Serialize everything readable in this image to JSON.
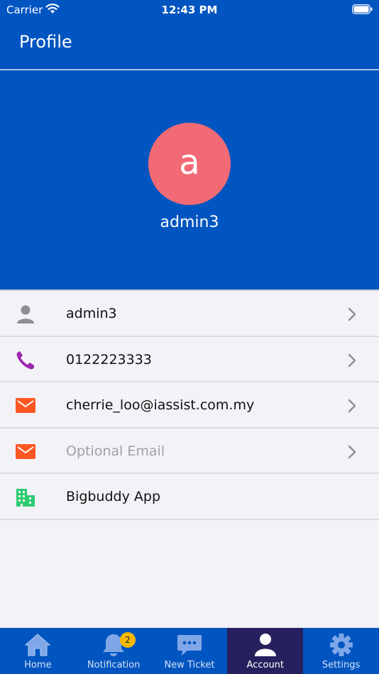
{
  "status_bar": {
    "carrier": "Carrier",
    "time": "12:43 PM",
    "icons": [
      "wifi-icon",
      "battery-icon"
    ]
  },
  "nav": {
    "title": "Profile"
  },
  "profile": {
    "avatar_letter": "a",
    "avatar_color": "#f16a75",
    "name": "admin3"
  },
  "info_rows": [
    {
      "label": "admin3",
      "icon": "user-icon",
      "icon_color": "#8e8e93",
      "chevron": true,
      "placeholder": false
    },
    {
      "label": "0122223333",
      "icon": "phone-icon",
      "icon_color": "#9c27b0",
      "chevron": true,
      "placeholder": false
    },
    {
      "label": "cherrie_loo@iassist.com.my",
      "icon": "mail-icon",
      "icon_color": "#ff5722",
      "chevron": true,
      "placeholder": false
    },
    {
      "label": "Optional Email",
      "icon": "mail-icon",
      "icon_color": "#ff5722",
      "chevron": true,
      "placeholder": true
    },
    {
      "label": "Bigbuddy App",
      "icon": "building-icon",
      "icon_color": "#2ecc71",
      "chevron": false,
      "placeholder": false
    }
  ],
  "tabs": [
    {
      "label": "Home",
      "icon": "home-icon",
      "active": false
    },
    {
      "label": "Notification",
      "icon": "bell-icon",
      "active": false,
      "badge": "2"
    },
    {
      "label": "New Ticket",
      "icon": "chat-icon",
      "active": false
    },
    {
      "label": "Account",
      "icon": "person-icon",
      "active": true
    },
    {
      "label": "Settings",
      "icon": "gear-icon",
      "active": false
    }
  ],
  "colors": {
    "brand_blue": "#0055c0",
    "active_tab": "#27205e",
    "badge": "#f7b900",
    "background": "#f2f2f7"
  }
}
